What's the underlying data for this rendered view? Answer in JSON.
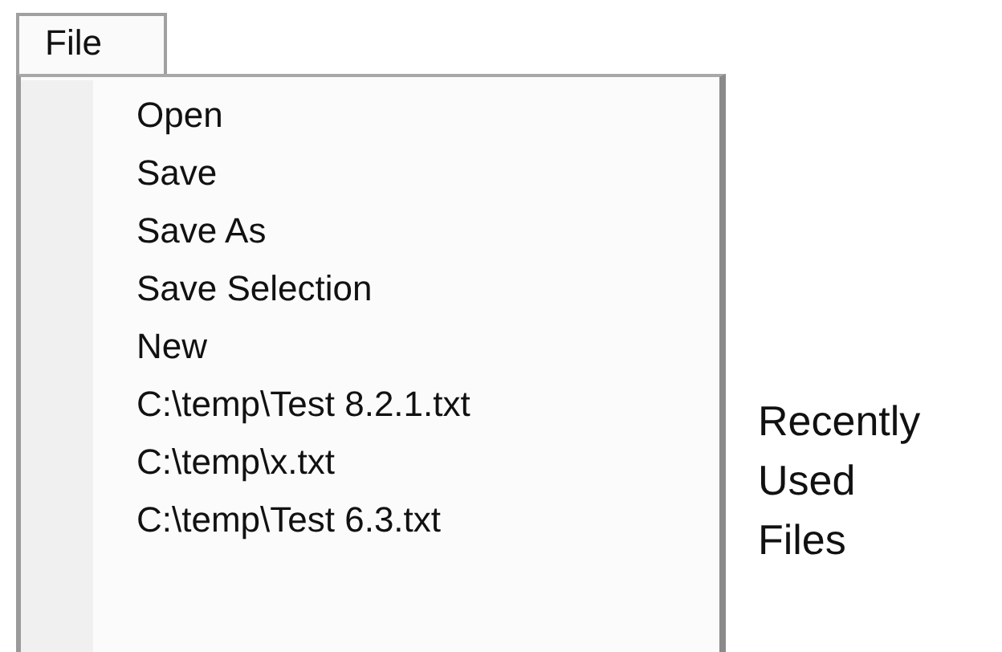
{
  "menu_bar": {
    "menus": [
      {
        "label": "File",
        "selected": true
      }
    ]
  },
  "menu": {
    "items": [
      {
        "label": "Open"
      },
      {
        "label": "Save"
      },
      {
        "label": "Save As"
      },
      {
        "label": "Save Selection"
      },
      {
        "label": "New"
      },
      {
        "label": "C:\\temp\\Test 8.2.1.txt"
      },
      {
        "label": "C:\\temp\\x.txt"
      },
      {
        "label": "C:\\temp\\Test 6.3.txt"
      }
    ]
  },
  "annotation": {
    "lines": [
      "Recently",
      "Used",
      "Files"
    ]
  }
}
